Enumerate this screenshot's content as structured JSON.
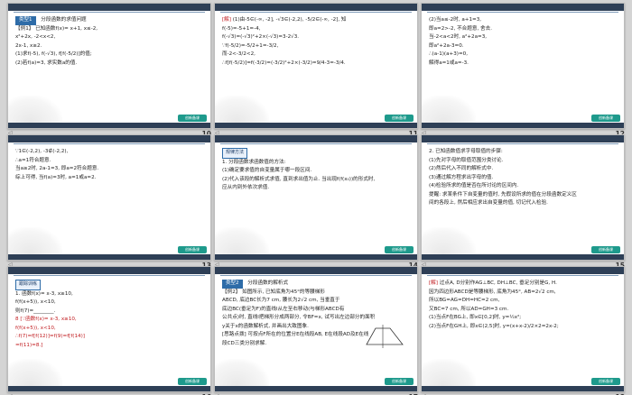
{
  "slides": [
    {
      "number": "10",
      "lines": [
        {
          "pre": "类型1",
          "text": "分段函数的求值问题"
        },
        {
          "text": "【例1】 已知函数f(x)= x+1, x≤-2,"
        },
        {
          "text": "x²+2x, -2<x<2,"
        },
        {
          "text": "2x-1, x≥2."
        },
        {
          "text": "(1)求f(-5), f(-√3), f[f(-5/2)]的值;"
        },
        {
          "text": "(2)若f(a)=3, 求实数a的值."
        }
      ]
    },
    {
      "number": "11",
      "lines": [
        {
          "pre": "[解]",
          "text": "(1)由-5∈(-∞, -2], -√3∈(-2,2), -5/2∈(-∞, -2], 知"
        },
        {
          "text": "f(-5)=-5+1=-4,"
        },
        {
          "text": "f(-√3)=(-√3)²+2×(-√3)=3-2√3."
        },
        {
          "text": "∵f(-5/2)=-5/2+1=-3/2,"
        },
        {
          "text": "而-2<-3/2<2,"
        },
        {
          "text": "∴f[f(-5/2)]=f(-3/2)=(-3/2)²+2×(-3/2)=9/4-3=-3/4."
        }
      ]
    },
    {
      "number": "12",
      "lines": [
        {
          "text": "(2)当a≤-2时, a+1=3,"
        },
        {
          "text": "即a=2>-2, 不合题意, 舍去."
        },
        {
          "text": "当-2<a<2时, a²+2a=3,"
        },
        {
          "text": "即a²+2a-3=0."
        },
        {
          "text": "∴(a-1)(a+3)=0,"
        },
        {
          "text": "解得a=1或a=-3."
        }
      ]
    },
    {
      "number": "13",
      "lines": [
        {
          "text": "∵1∈(-2,2), -3∉(-2,2),"
        },
        {
          "text": "∴a=1符合题意."
        },
        {
          "text": "当a≥2时, 2a-1=3, 即a=2符合题意."
        },
        {
          "text": "综上可得, 当f(a)=3时, a=1或a=2."
        }
      ]
    },
    {
      "number": "14",
      "lines": [
        {
          "pre": "规律方法",
          "text": ""
        },
        {
          "text": "1. 分段函数求函数值的方法:"
        },
        {
          "text": "(1)确定要求值的自变量属于哪一段区间."
        },
        {
          "text": "(2)代入该段的解析式求值, 直到求出值为止. 当出现f(f(x₀))的形式时,"
        },
        {
          "text": "应从内到外依次求值."
        }
      ]
    },
    {
      "number": "15",
      "lines": [
        {
          "text": "2. 已知函数值求字母取值的步骤:"
        },
        {
          "text": "(1)先对字母的取值范围分类讨论."
        },
        {
          "text": "(2)然后代入不同的解析式中."
        },
        {
          "text": "(3)通过解方程求出字母的值."
        },
        {
          "text": "(4)检验所求的值是否在所讨论的区间内."
        },
        {
          "text": "提醒: 求某条件下自变量的值时, 先假设所求的值在分段函数定义区"
        },
        {
          "text": "间的各段上, 然后相应求出自变量的值, 切记代入检验."
        }
      ]
    },
    {
      "number": "16",
      "lines": [
        {
          "pre": "跟踪训练",
          "text": ""
        },
        {
          "text": "1. 函数f(x)= x-3, x≥10,"
        },
        {
          "text": "f(f(x+5)), x<10,"
        },
        {
          "text": "则f(7)=________."
        },
        {
          "text": "8 [∵函数f(x)= x-3, x≥10,"
        },
        {
          "text": "f(f(x+5)), x<10,"
        },
        {
          "text": "∴f(7)=f[f(12)]=f(9)=f[f(14)]"
        },
        {
          "text": "=f(11)=8.]"
        }
      ]
    },
    {
      "number": "17",
      "lines": [
        {
          "pre": "类型2",
          "text": "分段函数的解析式"
        },
        {
          "text": "【例2】 如图所示, 已知底角为45°的等腰梯形"
        },
        {
          "text": "ABCD, 底边BC长为7 cm, 腰长为2√2 cm, 当垂直于"
        },
        {
          "text": "底边BC(垂足为F)的直线l从左至右移动(与梯形ABCD有"
        },
        {
          "text": "公共点)时, 直线l把梯形分成两部分, 令BF=x, 试写出左边部分的面积"
        },
        {
          "text": "y关于x的函数解析式, 并画出大致图象."
        },
        {
          "text": "[思路点拨] 可按点F所在的位置分E在线段AB, E在线段AD及E在线"
        },
        {
          "text": "段CD三类分别求解."
        }
      ]
    },
    {
      "number": "18",
      "lines": [
        {
          "pre": "[解]",
          "text": "过点A, D分别作AG⊥BC, DH⊥BC, 垂足分别是G, H."
        },
        {
          "text": "因为四边形ABCD是等腰梯形, 底角为45°, AB=2√2 cm,"
        },
        {
          "text": "所以BG=AG=DH=HC=2 cm,"
        },
        {
          "text": "又BC=7 cm, 所以AD=GH=3 cm."
        },
        {
          "text": "(1)当点F在BG上, 即x∈[0,2]时, y=½x²;"
        },
        {
          "text": "(2)当点F在GH上, 即x∈(2,5]时, y=(x+x-2)/2×2=2x-2;"
        }
      ]
    }
  ],
  "ui": {
    "corner_label": "创新备课",
    "nav_glyph": "◁"
  },
  "colors": {
    "slide_bar": "#2e3f56",
    "accent_tag": "#2e6ca8",
    "red_text": "#c0181c"
  }
}
